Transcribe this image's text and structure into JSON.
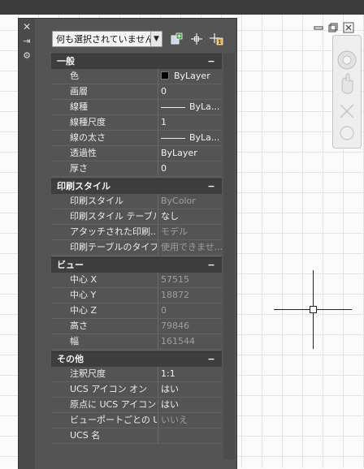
{
  "toolbar": {
    "selection_value": "何も選択されていません",
    "quick_select_icon": "quick-select-icon",
    "select_objects_icon": "select-objects-icon",
    "pickadd_icon": "pickadd-toggle-icon"
  },
  "strip": {
    "close_glyph": "✕",
    "autohide_glyph": "⇥",
    "settings_glyph": "⚙"
  },
  "categories": [
    {
      "title": "一般",
      "toggle": "−",
      "rows": [
        {
          "name": "色",
          "value": "ByLayer",
          "kind": "color"
        },
        {
          "name": "画層",
          "value": "0"
        },
        {
          "name": "線種",
          "value": "ByLa...",
          "kind": "line"
        },
        {
          "name": "線種尺度",
          "value": "1"
        },
        {
          "name": "線の太さ",
          "value": "ByLa...",
          "kind": "line"
        },
        {
          "name": "透過性",
          "value": "ByLayer"
        },
        {
          "name": "厚さ",
          "value": "0"
        }
      ]
    },
    {
      "title": "印刷スタイル",
      "toggle": "−",
      "rows": [
        {
          "name": "印刷スタイル",
          "value": "ByColor",
          "dim": true
        },
        {
          "name": "印刷スタイル テーブル",
          "value": "なし"
        },
        {
          "name": "アタッチされた印刷...",
          "value": "モデル",
          "dim": true
        },
        {
          "name": "印刷テーブルのタイプ",
          "value": "使用できませ...",
          "dim": true
        }
      ]
    },
    {
      "title": "ビュー",
      "toggle": "−",
      "rows": [
        {
          "name": "中心 X",
          "value": "57515",
          "dim": true
        },
        {
          "name": "中心 Y",
          "value": "18872",
          "dim": true
        },
        {
          "name": "中心 Z",
          "value": "0",
          "dim": true
        },
        {
          "name": "高さ",
          "value": "79846",
          "dim": true
        },
        {
          "name": "幅",
          "value": "161544",
          "dim": true
        }
      ]
    },
    {
      "title": "その他",
      "toggle": "−",
      "rows": [
        {
          "name": "注釈尺度",
          "value": "1:1"
        },
        {
          "name": "UCS アイコン オン",
          "value": "はい"
        },
        {
          "name": "原点に UCS アイコン",
          "value": "はい"
        },
        {
          "name": "ビューポートごとの U...",
          "value": "いいえ",
          "dim": true
        },
        {
          "name": "UCS 名",
          "value": ""
        }
      ]
    }
  ],
  "colors": {
    "swatch": "#000000"
  }
}
